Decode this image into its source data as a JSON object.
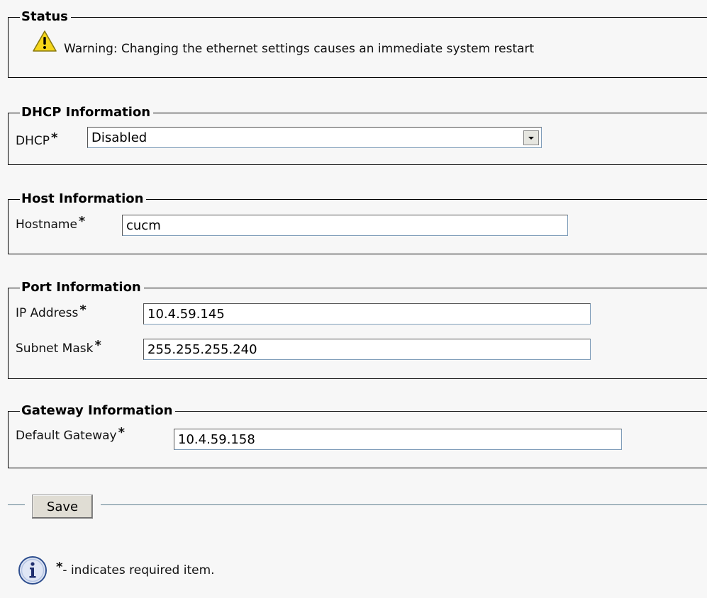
{
  "status": {
    "legend": "Status",
    "warning_text": "Warning: Changing the ethernet settings causes an immediate system restart",
    "icon": "warning-icon"
  },
  "dhcp": {
    "legend": "DHCP Information",
    "label": "DHCP",
    "required_mark": "*",
    "selected_value": "Disabled"
  },
  "host": {
    "legend": "Host Information",
    "label": "Hostname",
    "required_mark": "*",
    "value": "cucm"
  },
  "port": {
    "legend": "Port Information",
    "ip_label": "IP Address",
    "ip_value": "10.4.59.145",
    "mask_label": "Subnet Mask",
    "mask_value": "255.255.255.240",
    "required_mark": "*"
  },
  "gateway": {
    "legend": "Gateway Information",
    "label": "Default Gateway",
    "required_mark": "*",
    "value": "10.4.59.158"
  },
  "actions": {
    "save_label": "Save"
  },
  "footer": {
    "required_mark": "*",
    "note": "- indicates required item.",
    "icon": "info-icon"
  },
  "colors": {
    "background": "#f7f7f7",
    "divider": "#5d7f8f",
    "warning_yellow": "#f5d61a",
    "info_blue": "#2f4f8f"
  }
}
